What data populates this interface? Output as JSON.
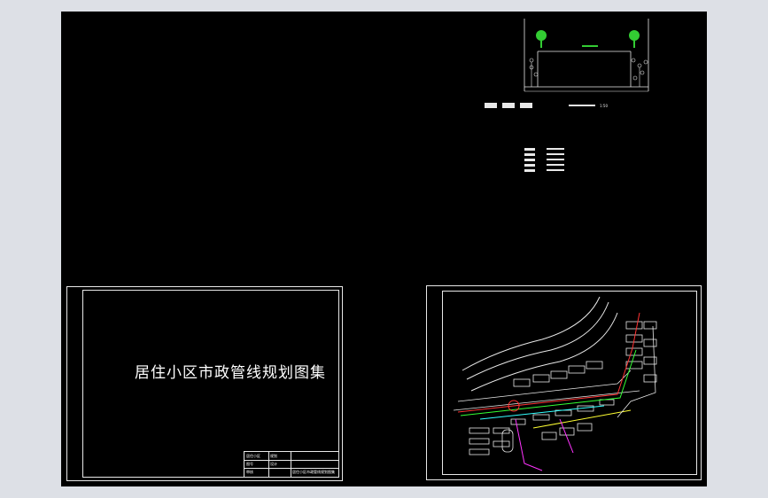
{
  "app": {
    "name": "CAD drawing viewer",
    "background_color": "#dde0e6",
    "canvas_color": "#000000",
    "line_color": "#e8e8e8"
  },
  "drawing": {
    "cover_sheet": {
      "title": "居住小区市政管线规划图集",
      "title_block": {
        "cells": [
          "居住小区",
          "规划",
          "图号",
          "设计",
          "审核",
          "居住小区市政管线规划图集"
        ]
      }
    },
    "section_view": {
      "scale_label": "1:50",
      "tree_color": "#33cc33",
      "dimension_color": "#ffffff"
    },
    "legend": {
      "entries": [
        "—",
        "—",
        "—",
        "—",
        "—"
      ]
    },
    "site_plan": {
      "pipe_colors": {
        "water": "#ff3333",
        "sewer": "#33ff33",
        "power": "#ff33ff",
        "gas": "#ffff33",
        "telecom": "#33ffff"
      }
    }
  }
}
